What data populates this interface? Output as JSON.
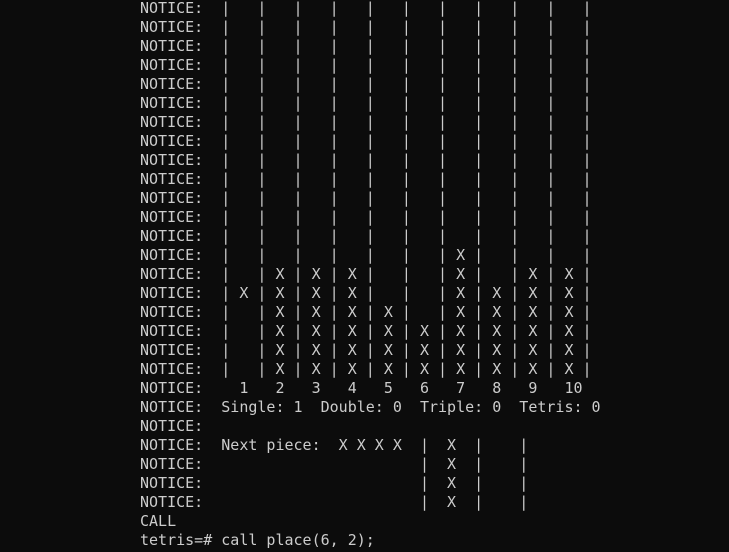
{
  "terminal": {
    "colors": {
      "background": "#0c0c0c",
      "text": "#cccccc"
    },
    "lines": [
      "NOTICE:  |   |   |   |   |   |   |   |   |   |   |",
      "NOTICE:  |   |   |   |   |   |   |   |   |   |   |",
      "NOTICE:  |   |   |   |   |   |   |   |   |   |   |",
      "NOTICE:  |   |   |   |   |   |   |   |   |   |   |",
      "NOTICE:  |   |   |   |   |   |   |   |   |   |   |",
      "NOTICE:  |   |   |   |   |   |   |   |   |   |   |",
      "NOTICE:  |   |   |   |   |   |   |   |   |   |   |",
      "NOTICE:  |   |   |   |   |   |   |   |   |   |   |",
      "NOTICE:  |   |   |   |   |   |   |   |   |   |   |",
      "NOTICE:  |   |   |   |   |   |   |   |   |   |   |",
      "NOTICE:  |   |   |   |   |   |   |   |   |   |   |",
      "NOTICE:  |   |   |   |   |   |   |   |   |   |   |",
      "NOTICE:  |   |   |   |   |   |   |   |   |   |   |",
      "NOTICE:  |   |   |   |   |   |   | X |   |   |   |",
      "NOTICE:  |   | X | X | X |   |   | X |   | X | X |",
      "NOTICE:  | X | X | X | X |   |   | X | X | X | X |",
      "NOTICE:  |   | X | X | X | X |   | X | X | X | X |",
      "NOTICE:  |   | X | X | X | X | X | X | X | X | X |",
      "NOTICE:  |   | X | X | X | X | X | X | X | X | X |",
      "NOTICE:  |   | X | X | X | X | X | X | X | X | X |",
      "NOTICE:    1   2   3   4   5   6   7   8   9   10",
      "NOTICE:  Single: 1  Double: 0  Triple: 0  Tetris: 0",
      "NOTICE:",
      "NOTICE:  Next piece:  X X X X  |  X  |    |",
      "NOTICE:                        |  X  |    |",
      "NOTICE:                        |  X  |    |",
      "NOTICE:                        |  X  |    |",
      "CALL",
      "tetris=# call place(6, 2);"
    ]
  }
}
